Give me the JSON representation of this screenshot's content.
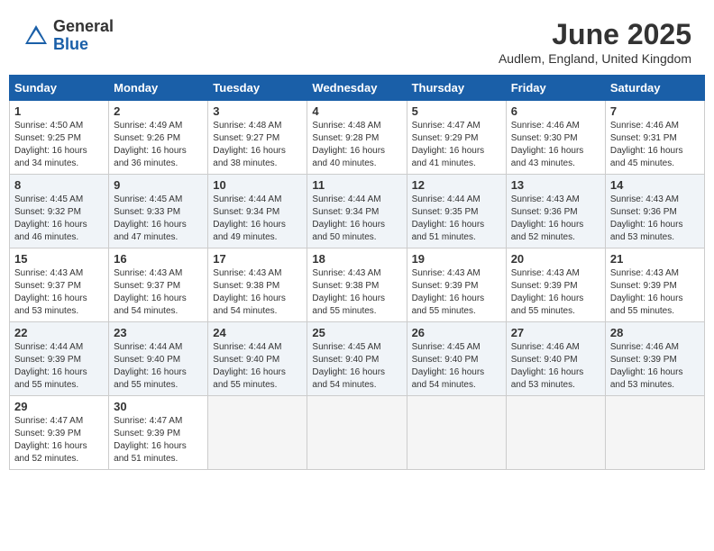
{
  "header": {
    "logo_general": "General",
    "logo_blue": "Blue",
    "month_title": "June 2025",
    "location": "Audlem, England, United Kingdom"
  },
  "weekdays": [
    "Sunday",
    "Monday",
    "Tuesday",
    "Wednesday",
    "Thursday",
    "Friday",
    "Saturday"
  ],
  "weeks": [
    [
      {
        "day": "1",
        "rise": "Sunrise: 4:50 AM",
        "set": "Sunset: 9:25 PM",
        "daylight": "Daylight: 16 hours and 34 minutes."
      },
      {
        "day": "2",
        "rise": "Sunrise: 4:49 AM",
        "set": "Sunset: 9:26 PM",
        "daylight": "Daylight: 16 hours and 36 minutes."
      },
      {
        "day": "3",
        "rise": "Sunrise: 4:48 AM",
        "set": "Sunset: 9:27 PM",
        "daylight": "Daylight: 16 hours and 38 minutes."
      },
      {
        "day": "4",
        "rise": "Sunrise: 4:48 AM",
        "set": "Sunset: 9:28 PM",
        "daylight": "Daylight: 16 hours and 40 minutes."
      },
      {
        "day": "5",
        "rise": "Sunrise: 4:47 AM",
        "set": "Sunset: 9:29 PM",
        "daylight": "Daylight: 16 hours and 41 minutes."
      },
      {
        "day": "6",
        "rise": "Sunrise: 4:46 AM",
        "set": "Sunset: 9:30 PM",
        "daylight": "Daylight: 16 hours and 43 minutes."
      },
      {
        "day": "7",
        "rise": "Sunrise: 4:46 AM",
        "set": "Sunset: 9:31 PM",
        "daylight": "Daylight: 16 hours and 45 minutes."
      }
    ],
    [
      {
        "day": "8",
        "rise": "Sunrise: 4:45 AM",
        "set": "Sunset: 9:32 PM",
        "daylight": "Daylight: 16 hours and 46 minutes."
      },
      {
        "day": "9",
        "rise": "Sunrise: 4:45 AM",
        "set": "Sunset: 9:33 PM",
        "daylight": "Daylight: 16 hours and 47 minutes."
      },
      {
        "day": "10",
        "rise": "Sunrise: 4:44 AM",
        "set": "Sunset: 9:34 PM",
        "daylight": "Daylight: 16 hours and 49 minutes."
      },
      {
        "day": "11",
        "rise": "Sunrise: 4:44 AM",
        "set": "Sunset: 9:34 PM",
        "daylight": "Daylight: 16 hours and 50 minutes."
      },
      {
        "day": "12",
        "rise": "Sunrise: 4:44 AM",
        "set": "Sunset: 9:35 PM",
        "daylight": "Daylight: 16 hours and 51 minutes."
      },
      {
        "day": "13",
        "rise": "Sunrise: 4:43 AM",
        "set": "Sunset: 9:36 PM",
        "daylight": "Daylight: 16 hours and 52 minutes."
      },
      {
        "day": "14",
        "rise": "Sunrise: 4:43 AM",
        "set": "Sunset: 9:36 PM",
        "daylight": "Daylight: 16 hours and 53 minutes."
      }
    ],
    [
      {
        "day": "15",
        "rise": "Sunrise: 4:43 AM",
        "set": "Sunset: 9:37 PM",
        "daylight": "Daylight: 16 hours and 53 minutes."
      },
      {
        "day": "16",
        "rise": "Sunrise: 4:43 AM",
        "set": "Sunset: 9:37 PM",
        "daylight": "Daylight: 16 hours and 54 minutes."
      },
      {
        "day": "17",
        "rise": "Sunrise: 4:43 AM",
        "set": "Sunset: 9:38 PM",
        "daylight": "Daylight: 16 hours and 54 minutes."
      },
      {
        "day": "18",
        "rise": "Sunrise: 4:43 AM",
        "set": "Sunset: 9:38 PM",
        "daylight": "Daylight: 16 hours and 55 minutes."
      },
      {
        "day": "19",
        "rise": "Sunrise: 4:43 AM",
        "set": "Sunset: 9:39 PM",
        "daylight": "Daylight: 16 hours and 55 minutes."
      },
      {
        "day": "20",
        "rise": "Sunrise: 4:43 AM",
        "set": "Sunset: 9:39 PM",
        "daylight": "Daylight: 16 hours and 55 minutes."
      },
      {
        "day": "21",
        "rise": "Sunrise: 4:43 AM",
        "set": "Sunset: 9:39 PM",
        "daylight": "Daylight: 16 hours and 55 minutes."
      }
    ],
    [
      {
        "day": "22",
        "rise": "Sunrise: 4:44 AM",
        "set": "Sunset: 9:39 PM",
        "daylight": "Daylight: 16 hours and 55 minutes."
      },
      {
        "day": "23",
        "rise": "Sunrise: 4:44 AM",
        "set": "Sunset: 9:40 PM",
        "daylight": "Daylight: 16 hours and 55 minutes."
      },
      {
        "day": "24",
        "rise": "Sunrise: 4:44 AM",
        "set": "Sunset: 9:40 PM",
        "daylight": "Daylight: 16 hours and 55 minutes."
      },
      {
        "day": "25",
        "rise": "Sunrise: 4:45 AM",
        "set": "Sunset: 9:40 PM",
        "daylight": "Daylight: 16 hours and 54 minutes."
      },
      {
        "day": "26",
        "rise": "Sunrise: 4:45 AM",
        "set": "Sunset: 9:40 PM",
        "daylight": "Daylight: 16 hours and 54 minutes."
      },
      {
        "day": "27",
        "rise": "Sunrise: 4:46 AM",
        "set": "Sunset: 9:40 PM",
        "daylight": "Daylight: 16 hours and 53 minutes."
      },
      {
        "day": "28",
        "rise": "Sunrise: 4:46 AM",
        "set": "Sunset: 9:39 PM",
        "daylight": "Daylight: 16 hours and 53 minutes."
      }
    ],
    [
      {
        "day": "29",
        "rise": "Sunrise: 4:47 AM",
        "set": "Sunset: 9:39 PM",
        "daylight": "Daylight: 16 hours and 52 minutes."
      },
      {
        "day": "30",
        "rise": "Sunrise: 4:47 AM",
        "set": "Sunset: 9:39 PM",
        "daylight": "Daylight: 16 hours and 51 minutes."
      },
      null,
      null,
      null,
      null,
      null
    ]
  ]
}
